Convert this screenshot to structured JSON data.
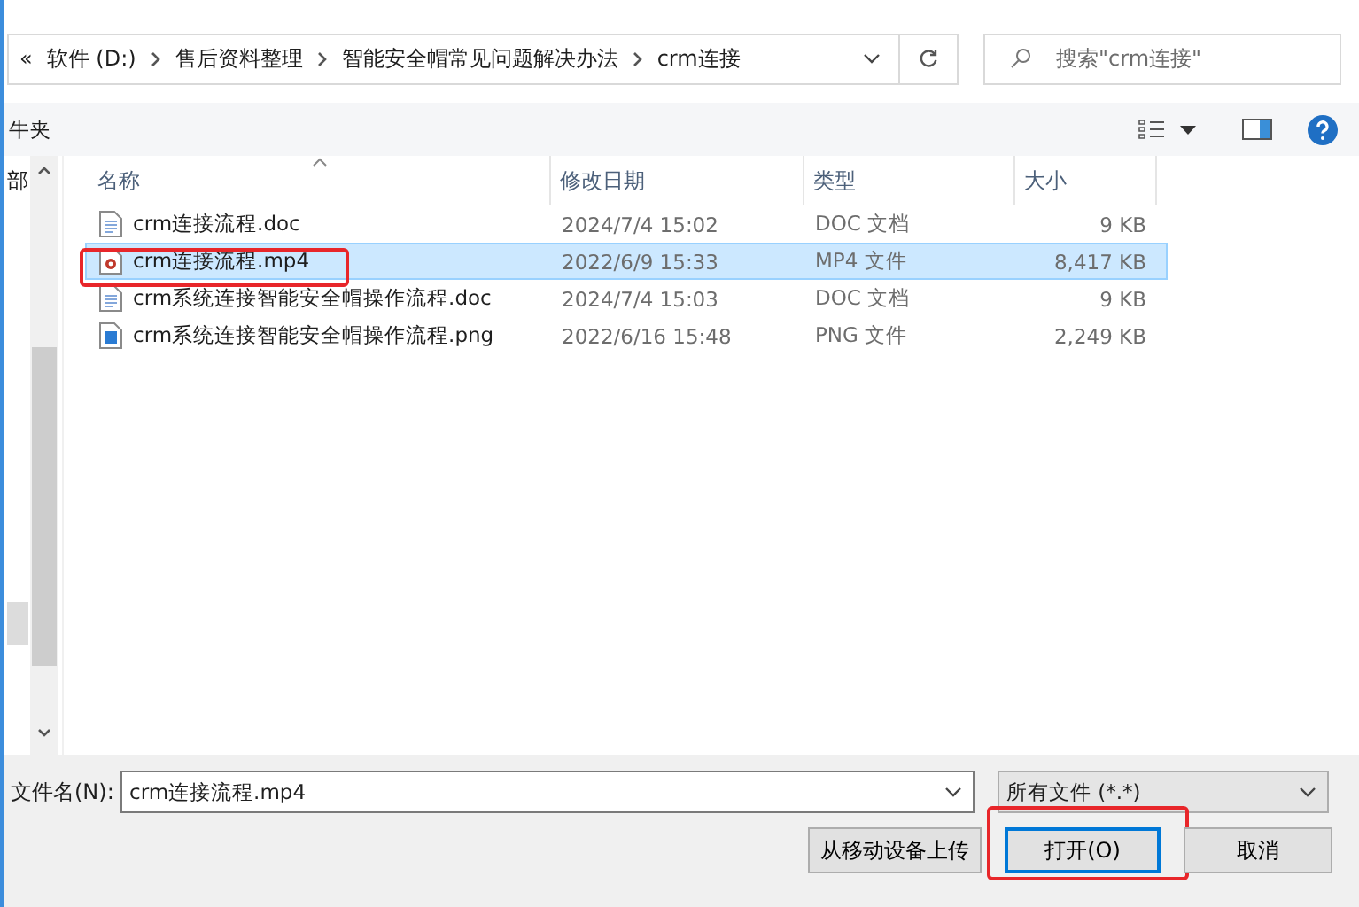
{
  "address_bar": {
    "overflow": "«",
    "path": [
      "软件 (D:)",
      "售后资料整理",
      "智能安全帽常见问题解决办法",
      "crm连接"
    ]
  },
  "search": {
    "placeholder": "搜索\"crm连接\""
  },
  "toolbar": {
    "label": "牛夹"
  },
  "nav_pane": {
    "items": [
      "部"
    ]
  },
  "table": {
    "columns": [
      {
        "label": "名称",
        "sorted": true
      },
      {
        "label": "修改日期",
        "sorted": false
      },
      {
        "label": "类型",
        "sorted": false
      },
      {
        "label": "大小",
        "sorted": false
      }
    ],
    "rows": [
      {
        "name": "crm连接流程.doc",
        "kind": "doc",
        "date": "2024/7/4 15:02",
        "type": "DOC 文档",
        "size": "9 KB",
        "selected": false,
        "highlighted": false
      },
      {
        "name": "crm连接流程.mp4",
        "kind": "video",
        "date": "2022/6/9 15:33",
        "type": "MP4 文件",
        "size": "8,417 KB",
        "selected": true,
        "highlighted": true
      },
      {
        "name": "crm系统连接智能安全帽操作流程.doc",
        "kind": "doc",
        "date": "2024/7/4 15:03",
        "type": "DOC 文档",
        "size": "9 KB",
        "selected": false,
        "highlighted": false
      },
      {
        "name": "crm系统连接智能安全帽操作流程.png",
        "kind": "image",
        "date": "2022/6/16 15:48",
        "type": "PNG 文件",
        "size": "2,249 KB",
        "selected": false,
        "highlighted": false
      }
    ]
  },
  "footer": {
    "filename_label": "文件名(N):",
    "filename": "crm连接流程.mp4",
    "filter": "所有文件 (*.*)",
    "buttons": [
      {
        "label": "从移动设备上传",
        "kind": "upload",
        "default": false,
        "highlighted": false
      },
      {
        "label": "打开(O)",
        "kind": "open",
        "default": true,
        "highlighted": true
      },
      {
        "label": "取消",
        "kind": "cancel",
        "default": false,
        "highlighted": false
      }
    ]
  }
}
